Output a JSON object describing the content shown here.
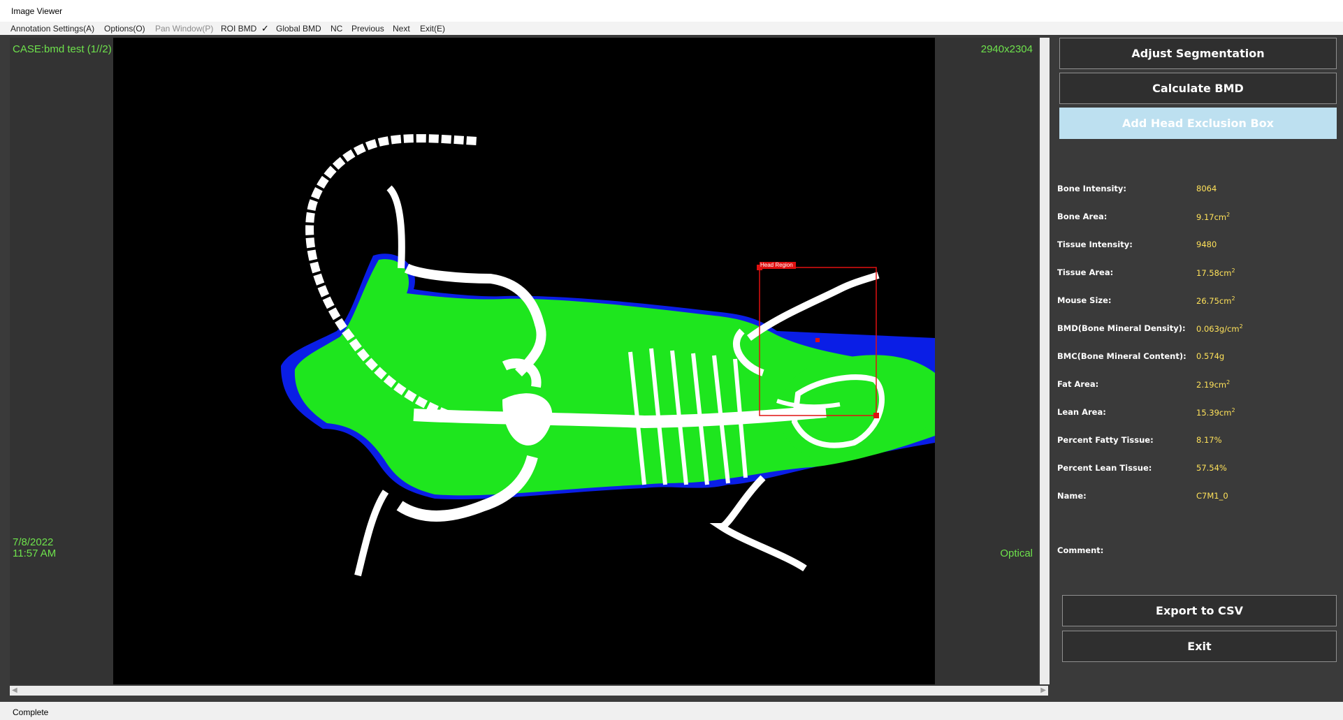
{
  "window": {
    "title": "Image Viewer"
  },
  "menu": {
    "items": [
      {
        "label": "Annotation Settings(A)",
        "enabled": true
      },
      {
        "label": "Options(O)",
        "enabled": true
      },
      {
        "label": "Pan Window(P)",
        "enabled": false
      },
      {
        "label": "ROI BMD",
        "enabled": true
      },
      {
        "label": "Global BMD",
        "enabled": true,
        "checked": true
      },
      {
        "label": "NC",
        "enabled": true
      },
      {
        "label": "Previous",
        "enabled": true
      },
      {
        "label": "Next",
        "enabled": true
      },
      {
        "label": "Exit(E)",
        "enabled": true
      }
    ]
  },
  "viewer": {
    "case_label": "CASE:bmd test (1//2)",
    "resolution": "2940x2304",
    "date": "7/8/2022",
    "time": "11:57 AM",
    "mode": "Optical",
    "roi_label": "Head Region"
  },
  "panel": {
    "buttons": {
      "adjust": "Adjust Segmentation",
      "calculate": "Calculate BMD",
      "head_box": "Add Head Exclusion Box",
      "export": "Export to CSV",
      "exit": "Exit"
    },
    "stats": [
      {
        "label": "Bone Intensity:",
        "value": "8064"
      },
      {
        "label": "Bone Area:",
        "value": "9.17cm",
        "unit_sup": "2"
      },
      {
        "label": "Tissue Intensity:",
        "value": "9480"
      },
      {
        "label": "Tissue Area:",
        "value": "17.58cm",
        "unit_sup": "2"
      },
      {
        "label": "Mouse Size:",
        "value": "26.75cm",
        "unit_sup": "2"
      },
      {
        "label": "BMD(Bone Mineral Density):",
        "value": "0.063g/cm",
        "unit_sup": "2"
      },
      {
        "label": "BMC(Bone Mineral Content):",
        "value": "0.574g"
      },
      {
        "label": "Fat Area:",
        "value": "2.19cm",
        "unit_sup": "2"
      },
      {
        "label": "Lean Area:",
        "value": "15.39cm",
        "unit_sup": "2"
      },
      {
        "label": "Percent Fatty Tissue:",
        "value": "8.17%"
      },
      {
        "label": "Percent Lean Tissue:",
        "value": "57.54%"
      },
      {
        "label": "Name:",
        "value": "C7M1_0"
      }
    ],
    "comment_label": "Comment:"
  },
  "status": {
    "text": "Complete"
  },
  "colors": {
    "overlay_text": "#6ee24c",
    "value_text": "#ffe25a",
    "lean_tissue": "#1ee61e",
    "fat_tissue": "#0a1ee6",
    "bone": "#ffffff",
    "roi_box": "#e01010"
  }
}
